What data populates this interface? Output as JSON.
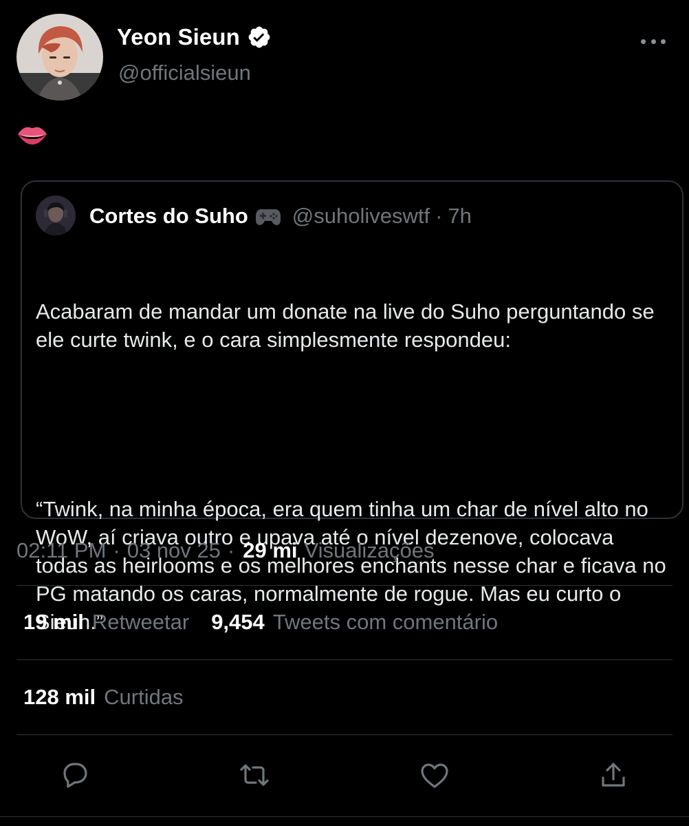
{
  "tweet": {
    "author": {
      "name": "Yeon Sieun",
      "handle": "@officialsieun",
      "verified": true,
      "avatar_icon": "profile-photo"
    },
    "text_emoji": "lips-emoji",
    "more_icon": "more-horizontal-icon",
    "quoted": {
      "author_name": "Cortes do Suho",
      "author_emoji": "video-game-controller-emoji",
      "handle": "@suholiveswtf",
      "separator": "·",
      "time": "7h",
      "paragraph1": "Acabaram de mandar um donate na live do Suho perguntando se ele curte twink, e o cara simplesmente respondeu:",
      "paragraph2": "“Twink, na minha época, era quem tinha um char de nível alto no WoW, aí criava outro e upava até o nível dezenove, colocava todas as heirlooms e os melhores enchants nesse char e ficava no PG matando os caras, normalmente de rogue. Mas eu curto o Sieun.”"
    },
    "meta": {
      "time": "02:11 PM",
      "sep1": "·",
      "date": "03 nov 25",
      "sep2": "·",
      "views_count": "29 mi",
      "views_label": "Visualizações"
    },
    "stats": {
      "retweets_count": "19 mil",
      "retweets_label": "Retweetar",
      "quotes_count": "9,454",
      "quotes_label": "Tweets com comentário",
      "likes_count": "128 mil",
      "likes_label": "Curtidas"
    },
    "actions": {
      "reply_icon": "reply-icon",
      "retweet_icon": "retweet-icon",
      "like_icon": "heart-icon",
      "share_icon": "share-icon"
    }
  },
  "colors": {
    "background": "#000000",
    "primary_text": "#e7e9ea",
    "secondary_text": "#71767b",
    "border": "#2f3336",
    "accent": "#1d9bf0"
  }
}
